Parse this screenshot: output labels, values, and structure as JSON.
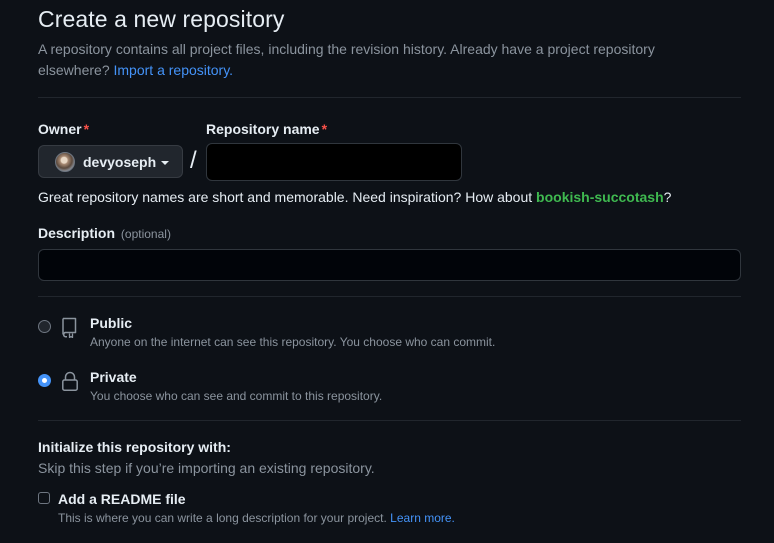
{
  "header": {
    "title": "Create a new repository",
    "subtitle": "A repository contains all project files, including the revision history. Already have a project repository elsewhere?",
    "import_link": "Import a repository."
  },
  "owner": {
    "label": "Owner",
    "required_mark": "*",
    "name": "devyoseph"
  },
  "separator": "/",
  "repo_name": {
    "label": "Repository name",
    "required_mark": "*",
    "value": ""
  },
  "hint": {
    "text": "Great repository names are short and memorable. Need inspiration? How about",
    "suggestion": "bookish-succotash",
    "suffix": "?"
  },
  "description": {
    "label": "Description",
    "optional": "(optional)",
    "value": ""
  },
  "visibility": {
    "selected": "private",
    "options": [
      {
        "id": "public",
        "title": "Public",
        "desc": "Anyone on the internet can see this repository. You choose who can commit.",
        "icon": "repo-icon"
      },
      {
        "id": "private",
        "title": "Private",
        "desc": "You choose who can see and commit to this repository.",
        "icon": "lock-icon"
      }
    ]
  },
  "init": {
    "title": "Initialize this repository with:",
    "subtitle": "Skip this step if you’re importing an existing repository.",
    "readme_label": "Add a README file",
    "readme_checked": false,
    "readme_desc": "This is where you can write a long description for your project.",
    "learn_more": "Learn more."
  },
  "colors": {
    "background": "#0d1117",
    "link": "#4493f8",
    "suggestion": "#3fb950",
    "required": "#f85149"
  }
}
